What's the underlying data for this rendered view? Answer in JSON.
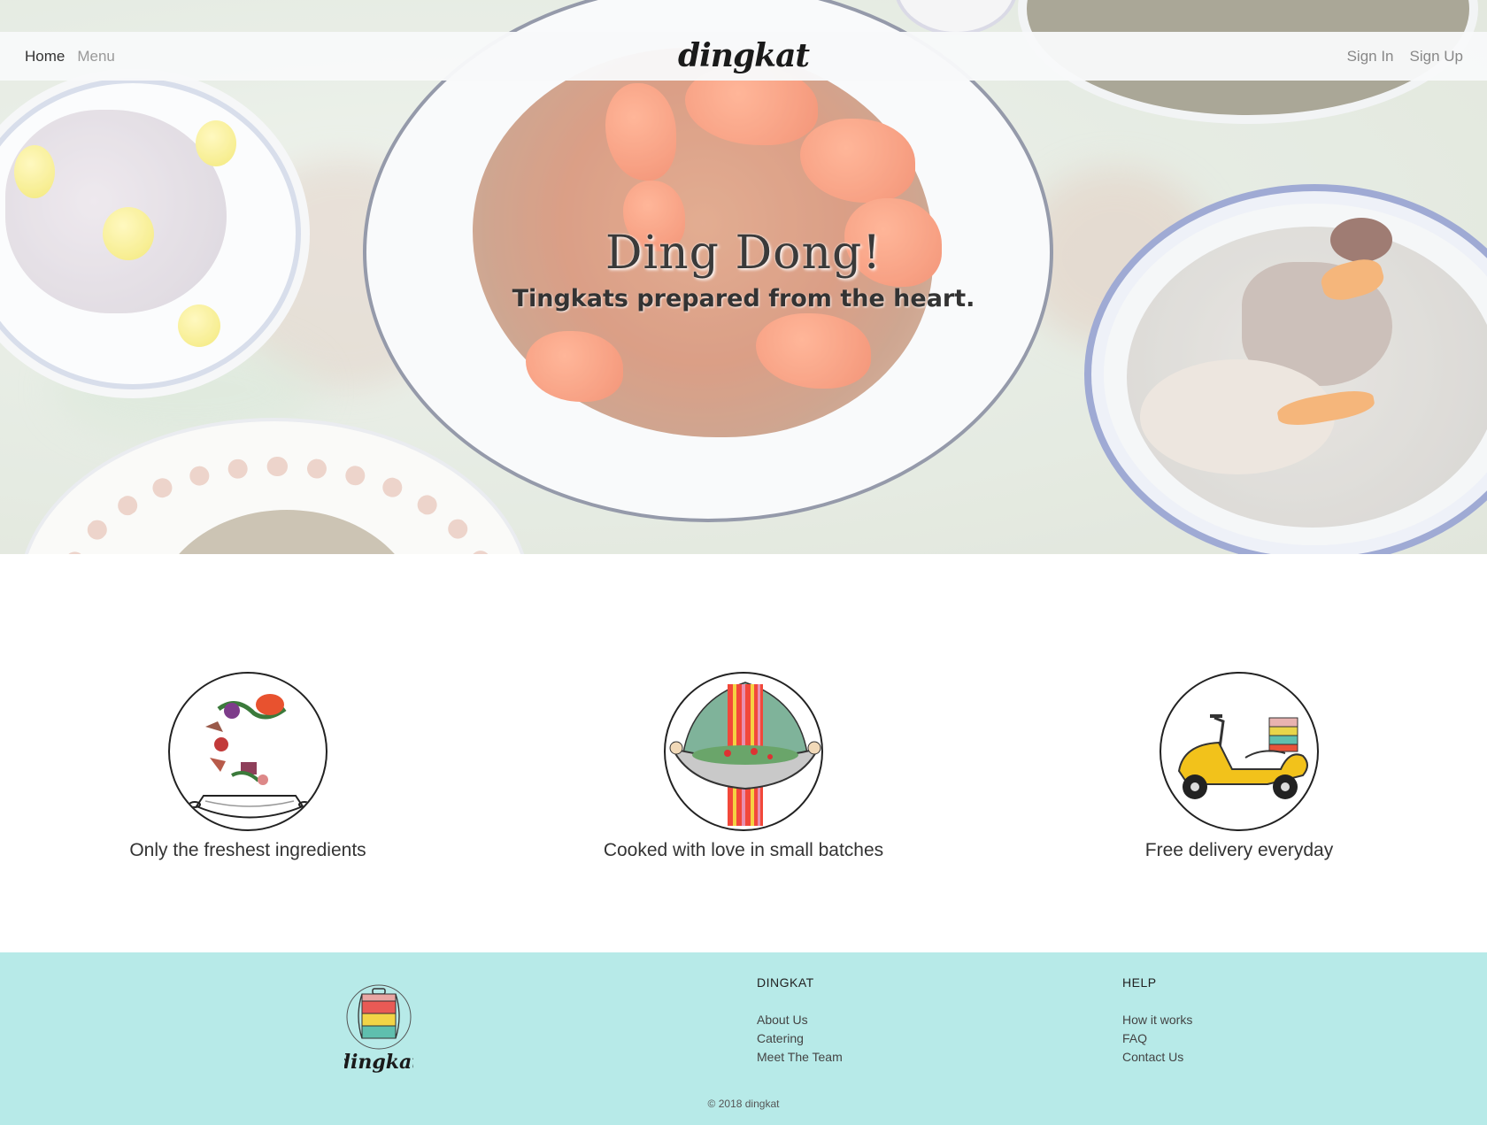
{
  "nav": {
    "left_links": [
      "Home",
      "Menu"
    ],
    "brand": "dingkat",
    "right_links": [
      "Sign In",
      "Sign Up"
    ]
  },
  "hero": {
    "title": "Ding Dong!",
    "subtitle": "Tingkats prepared from the heart."
  },
  "features": [
    {
      "caption": "Only the freshest ingredients",
      "icon": "wok-ingredients-icon"
    },
    {
      "caption": "Cooked with love in small batches",
      "icon": "cook-with-wok-icon"
    },
    {
      "caption": "Free delivery everyday",
      "icon": "delivery-scooter-icon"
    }
  ],
  "footer": {
    "logo_text": "dingkat",
    "columns": [
      {
        "heading": "DINGKAT",
        "links": [
          "About Us",
          "Catering",
          "Meet The Team"
        ]
      },
      {
        "heading": "HELP",
        "links": [
          "How it works",
          "FAQ",
          "Contact Us"
        ]
      }
    ],
    "copyright": "© 2018 dingkat"
  },
  "colors": {
    "footer_bg": "#b7eae8",
    "navbar_bg": "#f8f9fa",
    "scooter": "#f2c21b"
  }
}
